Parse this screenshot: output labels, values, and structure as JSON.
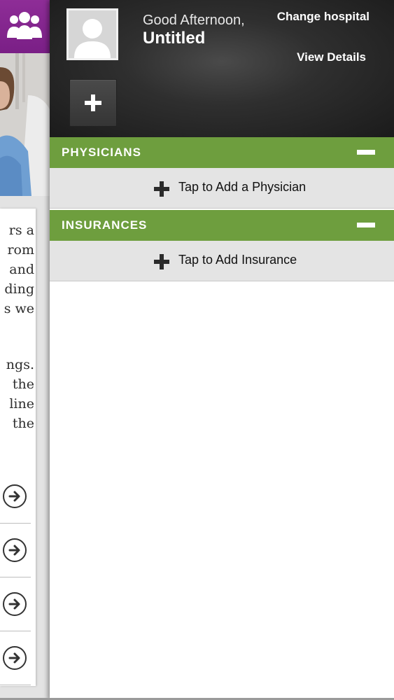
{
  "background_page": {
    "header_icon": "group-icon",
    "text_fragments": [
      "rs a",
      "rom",
      "and",
      "ding",
      "s we",
      "ngs.",
      "the",
      "line",
      "the"
    ],
    "arrow_rows": [
      {
        "icon": "arrow-right-circle-icon"
      },
      {
        "icon": "arrow-right-circle-icon"
      },
      {
        "icon": "arrow-right-circle-icon"
      },
      {
        "icon": "arrow-right-circle-icon"
      }
    ]
  },
  "profile": {
    "greeting": "Good Afternoon,",
    "name": "Untitled",
    "change_hospital_label": "Change hospital",
    "view_details_label": "View Details",
    "avatar_icon": "avatar-placeholder-icon",
    "add_button_icon": "plus-icon"
  },
  "sections": {
    "physicians": {
      "title": "PHYSICIANS",
      "add_label": "Tap to Add a Physician"
    },
    "insurances": {
      "title": "INSURANCES",
      "add_label": "Tap to Add Insurance"
    }
  },
  "colors": {
    "section_green": "#6e9e3e",
    "header_purple": "#7a1f86",
    "header_dark": "#2f2f2f"
  }
}
